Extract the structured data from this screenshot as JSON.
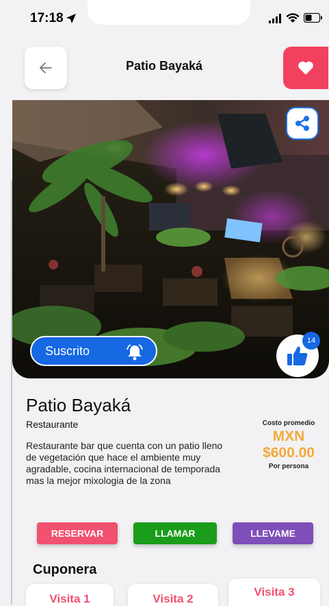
{
  "status_bar": {
    "time": "17:18"
  },
  "header": {
    "title": "Patio Bayaká"
  },
  "hero": {
    "subscribe_label": "Suscrito",
    "like_count": "14"
  },
  "restaurant": {
    "name": "Patio Bayaká",
    "category": "Restaurante",
    "description": "Restaurante bar que cuenta con un patio lleno de vegetación que hace el ambiente muy agradable, cocina internacional de temporada mas la mejor mixologia de la zona"
  },
  "price": {
    "label": "Costo promedio",
    "currency": "MXN",
    "value": "$600.00",
    "unit": "Por persona"
  },
  "actions": {
    "reservar": "RESERVAR",
    "llamar": "LLAMAR",
    "llevame": "LLEVAME"
  },
  "coupons": {
    "title": "Cuponera",
    "items": [
      "Visita 1",
      "Visita 2",
      "Visita 3"
    ]
  },
  "colors": {
    "accent_red": "#f2415f",
    "primary_blue": "#1668e3",
    "price_orange": "#f6a93b",
    "call_green": "#1a9d1a",
    "go_purple": "#7e4fb8"
  },
  "icons": [
    "location-arrow-icon",
    "signal-icon",
    "wifi-icon",
    "battery-icon",
    "back-arrow-icon",
    "heart-icon",
    "share-icon",
    "bell-icon",
    "thumbs-up-icon"
  ]
}
